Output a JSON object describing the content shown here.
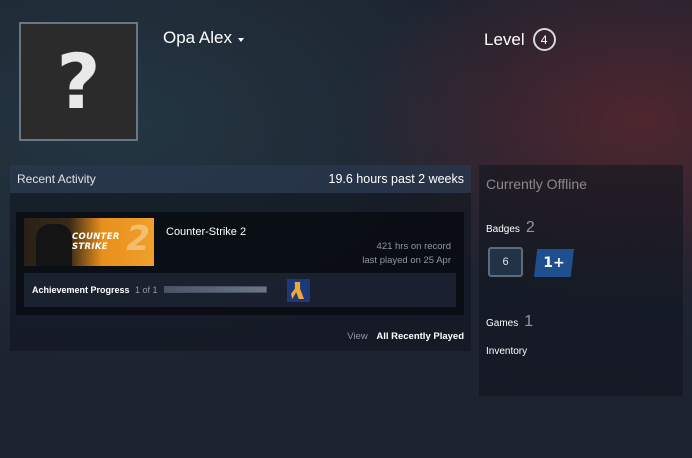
{
  "profile": {
    "avatar_glyph": "?",
    "persona_name": "Opa Alex",
    "level_label": "Level",
    "level_value": "4"
  },
  "recent_activity": {
    "title": "Recent Activity",
    "hours_summary": "19.6 hours past 2 weeks",
    "games": [
      {
        "name": "Counter-Strike 2",
        "capsule_title": "COUNTER STRIKE",
        "capsule_number": "2",
        "hours_on_record": "421 hrs on record",
        "last_played": "last played on 25 Apr",
        "achievement_label": "Achievement Progress",
        "achievement_count": "1 of 1",
        "achievement_progress": 1.0
      }
    ],
    "view_label": "View",
    "view_link": "All Recently Played"
  },
  "sidebar": {
    "status": "Currently Offline",
    "badges_label": "Badges",
    "badges_count": "2",
    "badge_items": [
      "6",
      "1+"
    ],
    "games_label": "Games",
    "games_count": "1",
    "inventory_label": "Inventory"
  },
  "colors": {
    "background": "#1d2330",
    "accent_orange": "#f0a02a",
    "text_white": "#ffffff",
    "text_muted": "#8f98a0"
  }
}
